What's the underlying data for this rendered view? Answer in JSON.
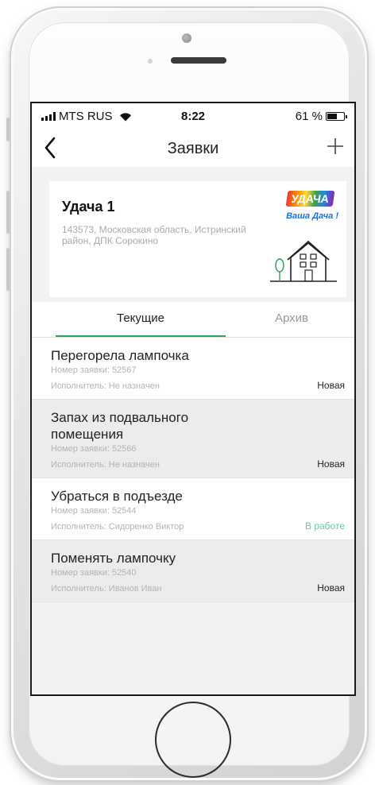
{
  "status_bar": {
    "carrier": "MTS RUS",
    "time": "8:22",
    "battery": "61 %",
    "battery_level": 0.61
  },
  "nav": {
    "title": "Заявки",
    "back_icon": "chevron-left-icon",
    "add_icon": "plus-icon"
  },
  "site": {
    "name": "Удача 1",
    "address": "143573, Московская область, Истринский район, ДПК Сорокино",
    "logo_title": "УДАЧА",
    "logo_subtitle": "Ваша Дача !"
  },
  "tabs": [
    {
      "label": "Текущие",
      "active": true
    },
    {
      "label": "Архив",
      "active": false
    }
  ],
  "requests": [
    {
      "title": "Перегорела лампочка",
      "number": "Номер заявки: 52567",
      "executor": "Исполнитель: Не назначен",
      "status": "Новая"
    },
    {
      "title": "Запах из подвального помещения",
      "number": "Номер заявки: 52566",
      "executor": "Исполнитель: Не назначен",
      "status": "Новая"
    },
    {
      "title": "Убраться в подъезде",
      "number": "Номер заявки: 52544",
      "executor": "Исполнитель: Сидоренко Виктор",
      "status": "В работе"
    },
    {
      "title": "Поменять лампочку",
      "number": "Номер заявки: 52540",
      "executor": "Исполнитель: Иванов Иван",
      "status": "Новая"
    }
  ],
  "colors": {
    "accent_green": "#2e9e5b",
    "status_in_work": "#6ec8a0"
  }
}
